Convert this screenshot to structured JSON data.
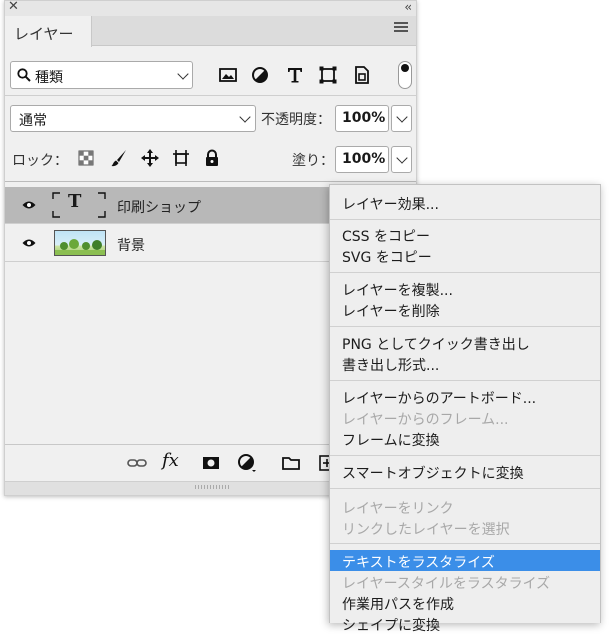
{
  "panel": {
    "tab_label": "レイヤー",
    "filter": {
      "selected": "種類"
    },
    "blend": {
      "selected": "通常"
    },
    "opacity": {
      "label": "不透明度：",
      "value": "100%"
    },
    "lock": {
      "label": "ロック："
    },
    "fill": {
      "label": "塗り：",
      "value": "100%"
    },
    "text_thumb_glyph": "T",
    "bottom_fx": "fx",
    "layers": [
      {
        "name": "印刷ショップ",
        "type": "text",
        "visible": true,
        "selected": true
      },
      {
        "name": "背景",
        "type": "image",
        "visible": true,
        "selected": false
      }
    ]
  },
  "context_menu": {
    "items": [
      {
        "label": "レイヤー効果...",
        "state": "normal"
      },
      {
        "label": "CSS をコピー",
        "state": "normal"
      },
      {
        "label": "SVG をコピー",
        "state": "normal"
      },
      {
        "label": "レイヤーを複製...",
        "state": "normal"
      },
      {
        "label": "レイヤーを削除",
        "state": "normal"
      },
      {
        "label": "PNG としてクイック書き出し",
        "state": "normal"
      },
      {
        "label": "書き出し形式...",
        "state": "normal"
      },
      {
        "label": "レイヤーからのアートボード...",
        "state": "normal"
      },
      {
        "label": "レイヤーからのフレーム...",
        "state": "disabled"
      },
      {
        "label": "フレームに変換",
        "state": "normal"
      },
      {
        "label": "スマートオブジェクトに変換",
        "state": "normal"
      },
      {
        "label": "レイヤーをリンク",
        "state": "disabled"
      },
      {
        "label": "リンクしたレイヤーを選択",
        "state": "disabled"
      },
      {
        "label": "テキストをラスタライズ",
        "state": "highlighted"
      },
      {
        "label": "レイヤースタイルをラスタライズ",
        "state": "disabled"
      },
      {
        "label": "作業用パスを作成",
        "state": "normal"
      },
      {
        "label": "シェイプに変換",
        "state": "normal"
      }
    ]
  },
  "colors": {
    "highlight": "#3b8ee8",
    "panel_bg": "#f0f0f0",
    "selected_row": "#b8b8b8"
  }
}
